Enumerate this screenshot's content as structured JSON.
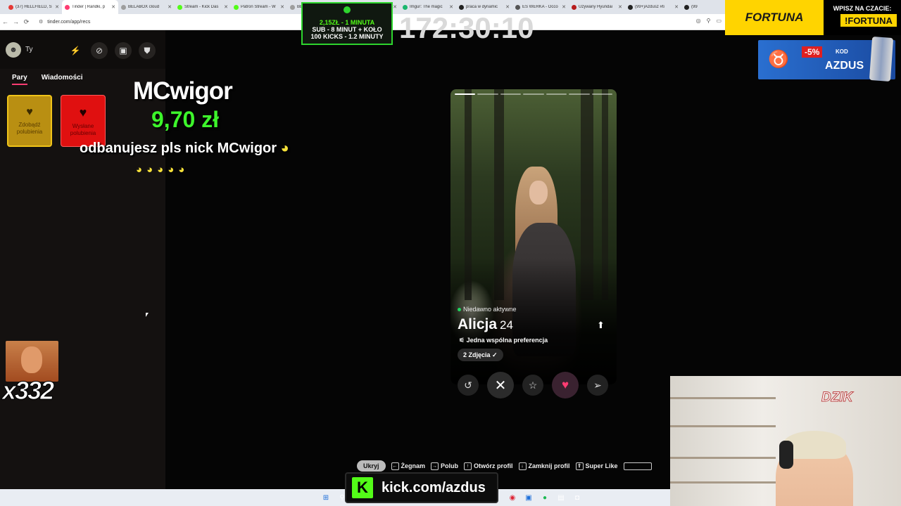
{
  "browser": {
    "tabs": [
      {
        "title": "(37) HELLFIELD, S",
        "color": "#e53935"
      },
      {
        "title": "Tinder | Randki, p",
        "color": "#fe3c72"
      },
      {
        "title": "BELABOX cloud",
        "color": "#9e9e9e"
      },
      {
        "title": "Stream - Kick Das",
        "color": "#53fc18"
      },
      {
        "title": "Patron Stream - W",
        "color": "#53fc18"
      },
      {
        "title": "BELABOX cloud",
        "color": "#9e9e9e"
      },
      {
        "title": "Rower szosowy T",
        "color": "#e91e63"
      },
      {
        "title": "Imgur: The magic",
        "color": "#1bb76e"
      },
      {
        "title": "praca w dynamic",
        "color": "#222222"
      },
      {
        "title": "ES WERKA - Occo",
        "color": "#555555"
      },
      {
        "title": "Używany Hyundai",
        "color": "#b71c1c"
      },
      {
        "title": "(99+)Azdusz #ti",
        "color": "#222222"
      },
      {
        "title": "(99",
        "color": "#222222"
      }
    ],
    "url": "tinder.com/app/recs"
  },
  "sidebar": {
    "user_label": "Ty",
    "tabs": [
      "Pary",
      "Wiadomości"
    ],
    "likes_card_label": "Zdobądź polubienia",
    "sent_card_label": "Wysłane polubienia"
  },
  "donation": {
    "donor": "MCwigor",
    "amount": "9,70 zł",
    "message": "odbanujesz pls nick MCwigor"
  },
  "counter": "x332",
  "goal": {
    "line1": "2,15ZŁ - 1 MINUTA",
    "line2": "SUB - 8 MINUT + KOŁO",
    "line3": "100 KICKS - 1.2 MINUTY"
  },
  "timer": "172:30:10",
  "sponsor": {
    "fortuna_logo": "FORTUNA",
    "fortuna_prompt": "WPISZ NA CZACIE:",
    "fortuna_tag": "!FORTUNA",
    "dzik_discount": "-5%",
    "dzik_kod": "KOD",
    "dzik_code": "AZDUS",
    "dzik_can": "DZIK",
    "cam_logo": "DZIK"
  },
  "profile": {
    "status": "Niedawno aktywne",
    "name": "Alicja",
    "age": "24",
    "preference": "Jedna wspólna preferencja",
    "photos": "2 Zdjęcia",
    "photo_count": 7,
    "current_photo": 1
  },
  "shortcuts": {
    "hide": "Ukryj",
    "nope": "Żegnam",
    "like": "Polub",
    "open": "Otwórz profil",
    "close": "Zamknij profil",
    "super": "Super Like"
  },
  "kick": {
    "logo": "K",
    "url": "kick.com/azdus"
  }
}
